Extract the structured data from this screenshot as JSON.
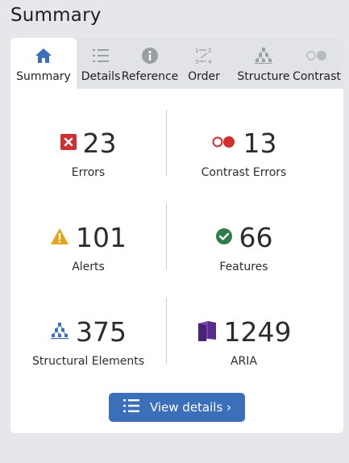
{
  "header": {
    "title": "Summary"
  },
  "tabs": [
    {
      "label": "Summary",
      "icon": "home-icon"
    },
    {
      "label": "Details",
      "icon": "list-icon"
    },
    {
      "label": "Reference",
      "icon": "info-icon"
    },
    {
      "label": "Order",
      "icon": "order-icon"
    },
    {
      "label": "Structure",
      "icon": "structure-icon"
    },
    {
      "label": "Contrast",
      "icon": "contrast-icon"
    }
  ],
  "stats": {
    "errors": {
      "value": "23",
      "label": "Errors",
      "icon": "error-icon"
    },
    "contrast_errors": {
      "value": "13",
      "label": "Contrast Errors",
      "icon": "contrast-error-icon"
    },
    "alerts": {
      "value": "101",
      "label": "Alerts",
      "icon": "alert-icon"
    },
    "features": {
      "value": "66",
      "label": "Features",
      "icon": "feature-icon"
    },
    "structural": {
      "value": "375",
      "label": "Structural Elements",
      "icon": "structure-icon"
    },
    "aria": {
      "value": "1249",
      "label": "ARIA",
      "icon": "aria-icon"
    }
  },
  "button": {
    "label": "View details ›",
    "icon": "list-icon"
  },
  "colors": {
    "accent": "#3b6fba",
    "error": "#d0302f",
    "alert": "#e8a317",
    "feature": "#2e7d4a",
    "aria": "#5a2d8c"
  }
}
